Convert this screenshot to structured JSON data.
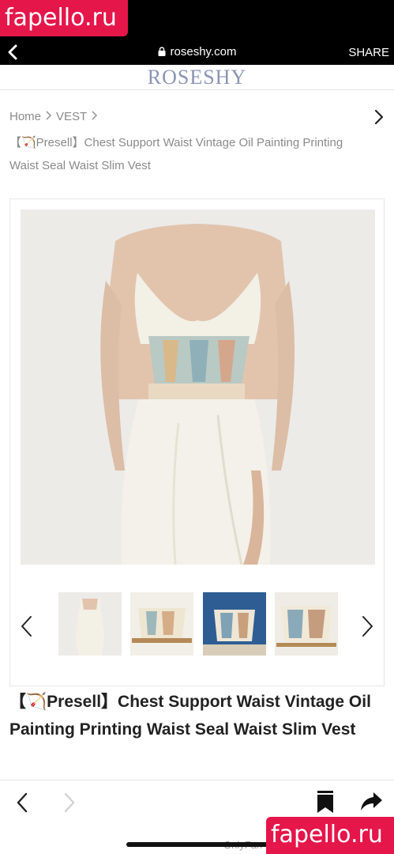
{
  "watermark": {
    "top": "fapello.ru",
    "bottom": "fapello.ru"
  },
  "browser": {
    "url": "roseshy.com",
    "share_label": "SHARE"
  },
  "site": {
    "logo": "ROSESHY"
  },
  "breadcrumb": {
    "home": "Home",
    "category": "VEST",
    "sep": ">",
    "product": "【🏹Presell】Chest Support Waist Vintage Oil Painting Printing Waist Seal Waist Slim Vest"
  },
  "product": {
    "title": "【🏹Presell】Chest Support Waist Vintage Oil Painting Printing Waist Seal Waist Slim Vest",
    "thumbnails": [
      "model-full",
      "corset-front",
      "corset-denim",
      "corset-detail"
    ]
  },
  "footer": {
    "overlay_text": "OnlyFan"
  },
  "colors": {
    "watermark": "#e5164a",
    "logo": "#8a95b5",
    "muted_text": "#8a8a8a"
  }
}
